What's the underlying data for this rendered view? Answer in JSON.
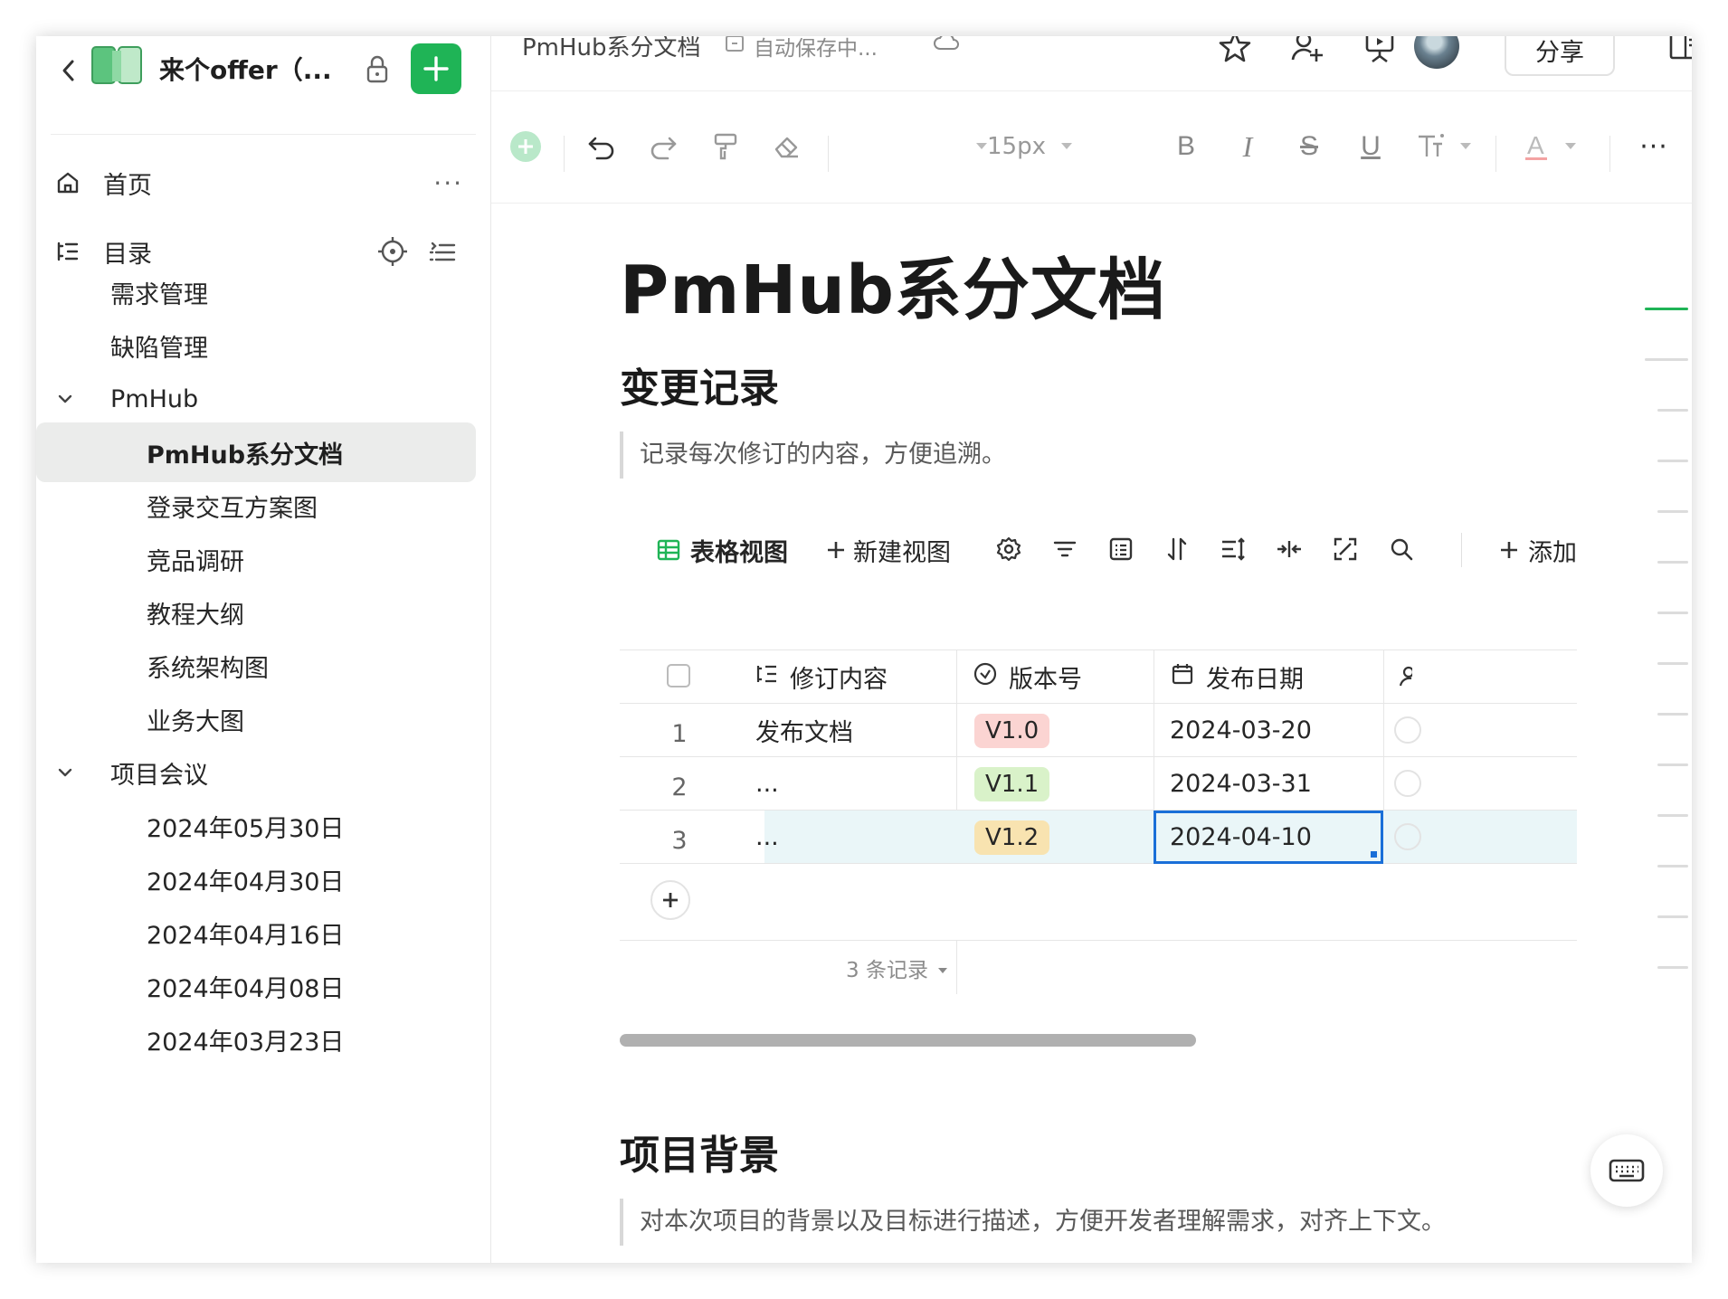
{
  "sidebar": {
    "space_title": "来个offer（...",
    "nav": {
      "home": "首页",
      "home_more": "···",
      "toc": "目录"
    },
    "items": [
      {
        "label": "需求管理"
      },
      {
        "label": "缺陷管理"
      },
      {
        "label": "PmHub",
        "expanded": true
      },
      {
        "label": "PmHub系分文档",
        "active": true
      },
      {
        "label": "登录交互方案图"
      },
      {
        "label": "竞品调研"
      },
      {
        "label": "教程大纲"
      },
      {
        "label": "系统架构图"
      },
      {
        "label": "业务大图"
      },
      {
        "label": "项目会议",
        "expanded": true
      },
      {
        "label": "2024年05月30日"
      },
      {
        "label": "2024年04月30日"
      },
      {
        "label": "2024年04月16日"
      },
      {
        "label": "2024年04月08日"
      },
      {
        "label": "2024年03月23日"
      }
    ]
  },
  "topbar": {
    "doc_name": "PmHub系分文档",
    "save_status": "自动保存中...",
    "share_label": "分享"
  },
  "toolbar": {
    "font_size": "15px",
    "icons": [
      "add-block-icon",
      "undo-icon",
      "redo-icon",
      "format-painter-icon",
      "eraser-icon",
      "bold-icon",
      "italic-icon",
      "strikethrough-icon",
      "underline-icon",
      "text-style-icon",
      "font-color-icon",
      "more-icon"
    ]
  },
  "doc": {
    "title": "PmHub系分文档",
    "section1_heading": "变更记录",
    "section1_quote": "记录每次修订的内容，方便追溯。",
    "section2_heading": "项目背景",
    "section2_quote": "对本次项目的背景以及目标进行描述，方便开发者理解需求，对齐上下文。"
  },
  "table_view": {
    "view_name": "表格视图",
    "new_view": "新建视图",
    "add_label": "添加"
  },
  "table": {
    "columns": [
      "修订内容",
      "版本号",
      "发布日期"
    ],
    "rows": [
      {
        "index": "1",
        "content": "发布文档",
        "version": "V1.0",
        "version_color": "#fbd4d2",
        "date": "2024-03-20"
      },
      {
        "index": "2",
        "content": "...",
        "version": "V1.1",
        "version_color": "#d9f2c9",
        "date": "2024-03-31"
      },
      {
        "index": "3",
        "content": "...",
        "version": "V1.2",
        "version_color": "#f8e3b0",
        "date": "2024-04-10"
      }
    ],
    "record_count": "3 条记录"
  },
  "colors": {
    "accent_green": "#1fb456",
    "selected_cell_border": "#1a6fd8",
    "selected_row_bg": "#eaf6f8"
  }
}
